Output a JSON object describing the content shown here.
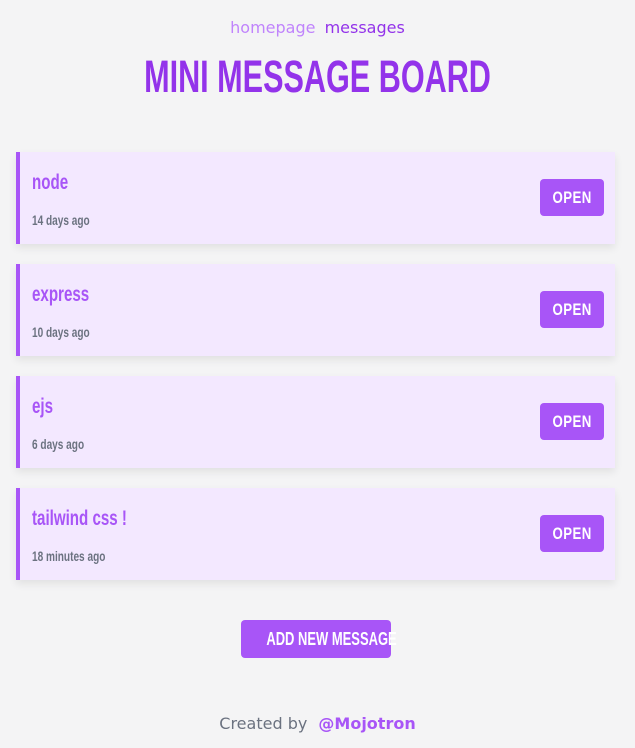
{
  "nav": {
    "homepage_label": "homepage",
    "messages_label": "messages"
  },
  "page_title": "MINI MESSAGE BOARD",
  "messages": [
    {
      "title": "node",
      "time": "14 days ago",
      "open_label": "OPEN"
    },
    {
      "title": "express",
      "time": "10 days ago",
      "open_label": "OPEN"
    },
    {
      "title": "ejs",
      "time": "6 days ago",
      "open_label": "OPEN"
    },
    {
      "title": "tailwind css !",
      "time": "18 minutes ago",
      "open_label": "OPEN"
    }
  ],
  "add_button_label": "ADD NEW MESSAGE",
  "footer": {
    "created_by_text": "Created by",
    "author_link": "@Mojotron"
  },
  "colors": {
    "background": "#f4f4f5",
    "accent": "#a855f7",
    "accent_dark": "#9333ea",
    "card_background": "#f3e8ff",
    "muted_text": "#6b7280"
  }
}
